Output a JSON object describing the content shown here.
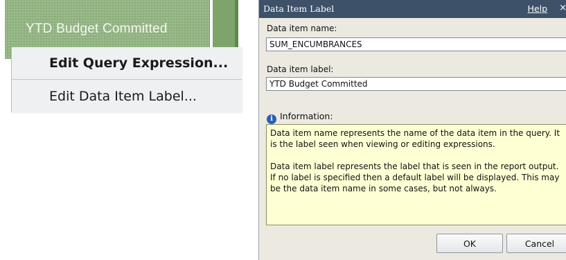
{
  "report": {
    "column_header_label": "YTD Budget Committed"
  },
  "context_menu": {
    "items": [
      {
        "label": "Edit Query Expression..."
      },
      {
        "label": "Edit Data Item Label..."
      }
    ]
  },
  "dialog": {
    "title": "Data Item Label",
    "help_label": "Help",
    "close_glyph": "×",
    "name_label": "Data item name:",
    "name_value": "SUM_ENCUMBRANCES",
    "item_label_label": "Data item label:",
    "item_label_value": "YTD Budget Committed",
    "info_icon": "i",
    "info_heading": "Information:",
    "info_paragraphs": [
      "Data item name represents the name of the data item in the query. It is the label seen when viewing or editing expressions.",
      "Data item label represents the label that is seen in the report output. If no label is specified then a default label will be displayed. This may be the data item name in some cases, but not always."
    ],
    "ok_label": "OK",
    "cancel_label": "Cancel"
  },
  "colors": {
    "header_green": "#8fb180",
    "titlebar": "#3d5168",
    "info_background": "#ffffd4"
  },
  "icons": {
    "info": "info-icon",
    "close": "close-icon"
  }
}
